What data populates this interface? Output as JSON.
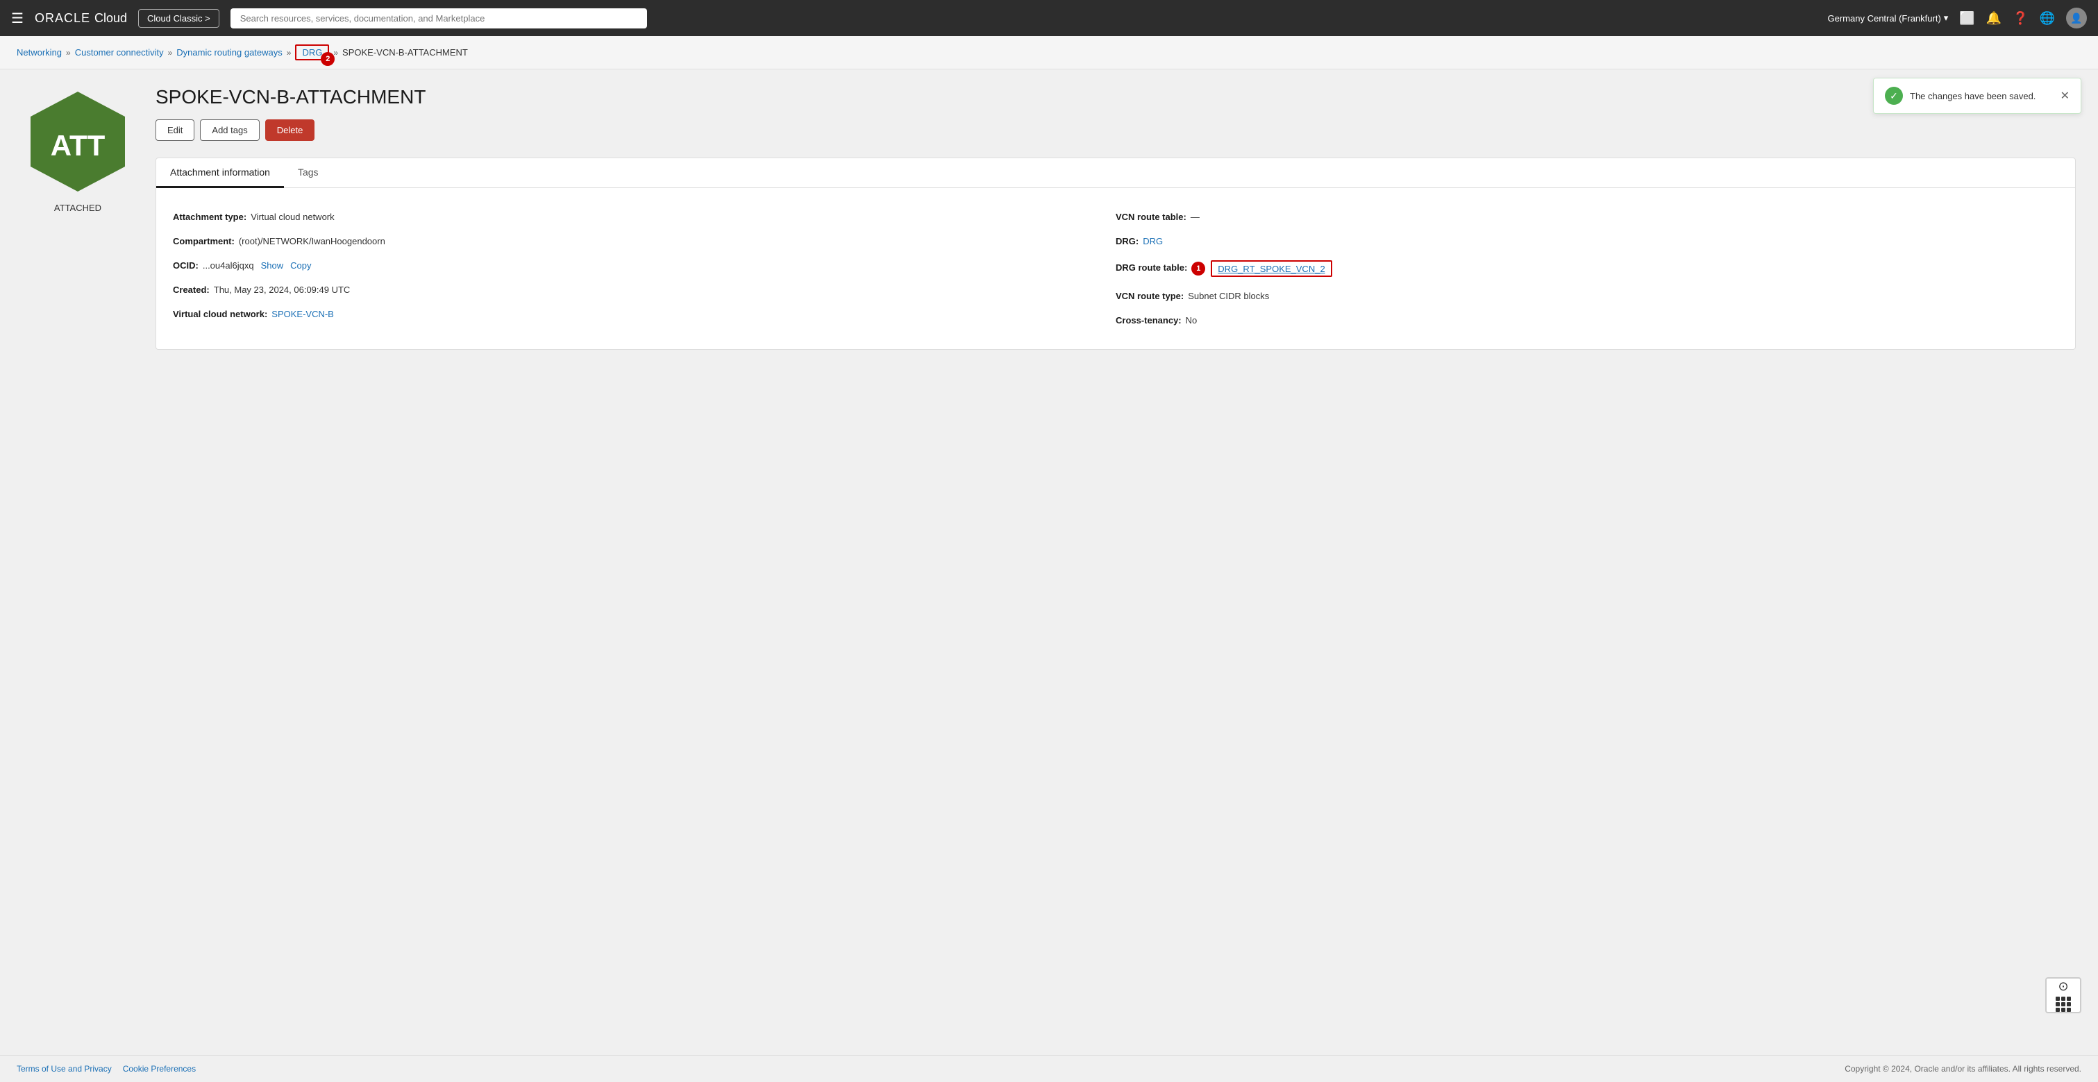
{
  "topbar": {
    "menu_icon": "☰",
    "oracle_text": "ORACLE",
    "cloud_text": "Cloud",
    "cloud_classic_label": "Cloud Classic >",
    "search_placeholder": "Search resources, services, documentation, and Marketplace",
    "region": "Germany Central (Frankfurt)",
    "region_chevron": "▾"
  },
  "breadcrumb": {
    "networking": "Networking",
    "customer_connectivity": "Customer connectivity",
    "dynamic_routing": "Dynamic routing gateways",
    "drg": "DRG",
    "badge_number": "2",
    "current": "SPOKE-VCN-B-ATTACHMENT"
  },
  "notification": {
    "message": "The changes have been saved.",
    "close": "✕"
  },
  "page": {
    "title": "SPOKE-VCN-B-ATTACHMENT",
    "hex_label": "ATTACHED",
    "hex_text": "ATT"
  },
  "actions": {
    "edit": "Edit",
    "add_tags": "Add tags",
    "delete": "Delete"
  },
  "tabs": [
    {
      "id": "attachment-info",
      "label": "Attachment information",
      "active": true
    },
    {
      "id": "tags",
      "label": "Tags",
      "active": false
    }
  ],
  "details": {
    "left": [
      {
        "label": "Attachment type:",
        "value": "Virtual cloud network",
        "type": "text"
      },
      {
        "label": "Compartment:",
        "value": "(root)/NETWORK/IwanHoogendoorn",
        "type": "text"
      },
      {
        "label": "OCID:",
        "value": "...ou4al6jqxq",
        "type": "ocid",
        "show": "Show",
        "copy": "Copy"
      },
      {
        "label": "Created:",
        "value": "Thu, May 23, 2024, 06:09:49 UTC",
        "type": "text"
      },
      {
        "label": "Virtual cloud network:",
        "value": "SPOKE-VCN-B",
        "type": "link"
      }
    ],
    "right": [
      {
        "label": "VCN route table:",
        "value": "—",
        "type": "text"
      },
      {
        "label": "DRG:",
        "value": "DRG",
        "type": "link"
      },
      {
        "label": "DRG route table:",
        "value": "DRG_RT_SPOKE_VCN_2",
        "type": "highlighted-link",
        "badge": "1"
      },
      {
        "label": "VCN route type:",
        "value": "Subnet CIDR blocks",
        "type": "text"
      },
      {
        "label": "Cross-tenancy:",
        "value": "No",
        "type": "text"
      }
    ]
  },
  "footer": {
    "terms": "Terms of Use and Privacy",
    "cookie": "Cookie Preferences",
    "copyright": "Copyright © 2024, Oracle and/or its affiliates. All rights reserved."
  }
}
